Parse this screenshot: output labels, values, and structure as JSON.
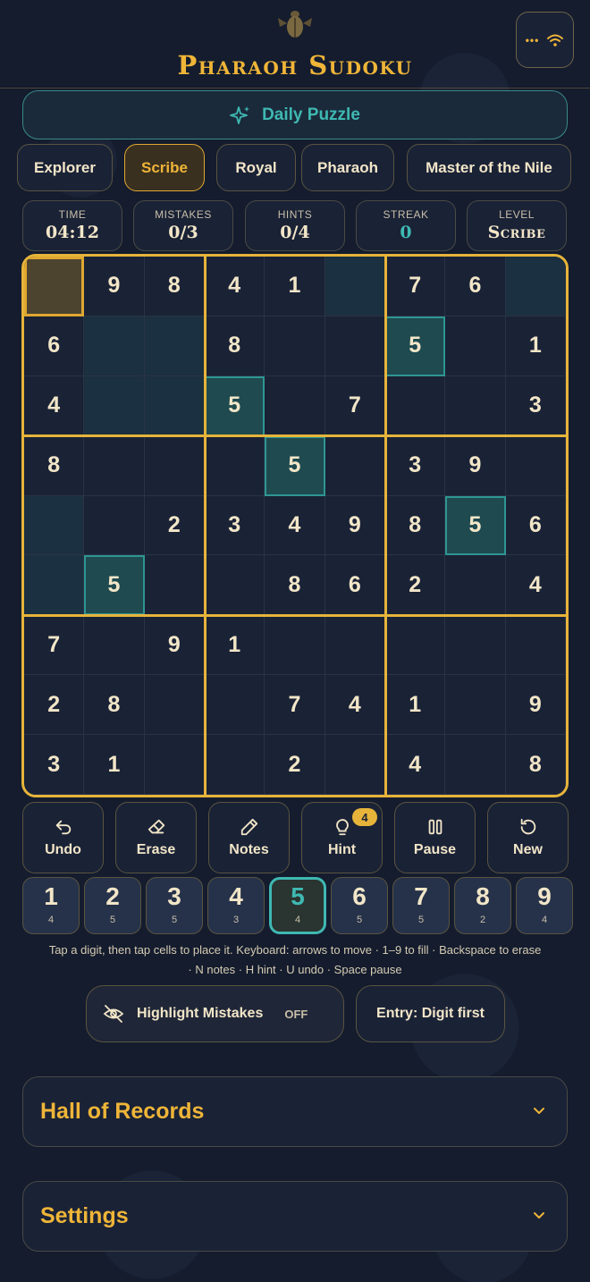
{
  "app": {
    "title": "Pharaoh Sudoku",
    "menu_dots": "•••"
  },
  "daily": {
    "label": "Daily Puzzle"
  },
  "difficulties": [
    {
      "label": "Explorer",
      "active": false
    },
    {
      "label": "Scribe",
      "active": true
    },
    {
      "label": "Royal",
      "active": false
    },
    {
      "label": "Pharaoh",
      "active": false
    },
    {
      "label": "Master of the Nile",
      "active": false
    }
  ],
  "stats": {
    "time": {
      "label": "TIME",
      "value": "04:12"
    },
    "mistakes": {
      "label": "MISTAKES",
      "value": "0/3"
    },
    "hints": {
      "label": "HINTS",
      "value": "0/4"
    },
    "streak": {
      "label": "STREAK",
      "value": "0"
    },
    "level": {
      "label": "LEVEL",
      "value": "Scribe"
    }
  },
  "board": {
    "grid": [
      [
        0,
        9,
        8,
        4,
        1,
        0,
        7,
        6,
        0
      ],
      [
        6,
        0,
        0,
        8,
        0,
        0,
        5,
        0,
        1
      ],
      [
        4,
        0,
        0,
        5,
        0,
        7,
        0,
        0,
        3
      ],
      [
        8,
        0,
        0,
        0,
        5,
        0,
        3,
        9,
        0
      ],
      [
        0,
        0,
        2,
        3,
        4,
        9,
        8,
        5,
        6
      ],
      [
        0,
        5,
        0,
        0,
        8,
        6,
        2,
        0,
        4
      ],
      [
        7,
        0,
        9,
        1,
        0,
        0,
        0,
        0,
        0
      ],
      [
        2,
        8,
        0,
        0,
        7,
        4,
        1,
        0,
        9
      ],
      [
        3,
        1,
        0,
        0,
        2,
        0,
        4,
        0,
        8
      ]
    ],
    "selected": [
      0,
      0
    ],
    "highlight_digit": 5
  },
  "tools": {
    "undo": "Undo",
    "erase": "Erase",
    "notes": "Notes",
    "hint": "Hint",
    "hint_badge": "4",
    "pause": "Pause",
    "new": "New"
  },
  "digits": [
    {
      "n": "1",
      "count": "4"
    },
    {
      "n": "2",
      "count": "5"
    },
    {
      "n": "3",
      "count": "5"
    },
    {
      "n": "4",
      "count": "3"
    },
    {
      "n": "5",
      "count": "4"
    },
    {
      "n": "6",
      "count": "5"
    },
    {
      "n": "7",
      "count": "5"
    },
    {
      "n": "8",
      "count": "2"
    },
    {
      "n": "9",
      "count": "4"
    }
  ],
  "active_digit": "5",
  "help": {
    "line1": "Tap a digit, then tap cells to place it. Keyboard: arrows to move · 1–9 to fill · Backspace to erase",
    "line2": "· N notes · H hint · U undo · Space pause"
  },
  "toggles": {
    "highlight_label": "Highlight Mistakes",
    "highlight_state": "OFF",
    "entry_label": "Entry: Digit first"
  },
  "sections": {
    "records": "Hall of Records",
    "settings": "Settings"
  },
  "colors": {
    "gold": "#efb538",
    "teal": "#3fb8b2",
    "background": "#141c2e"
  }
}
